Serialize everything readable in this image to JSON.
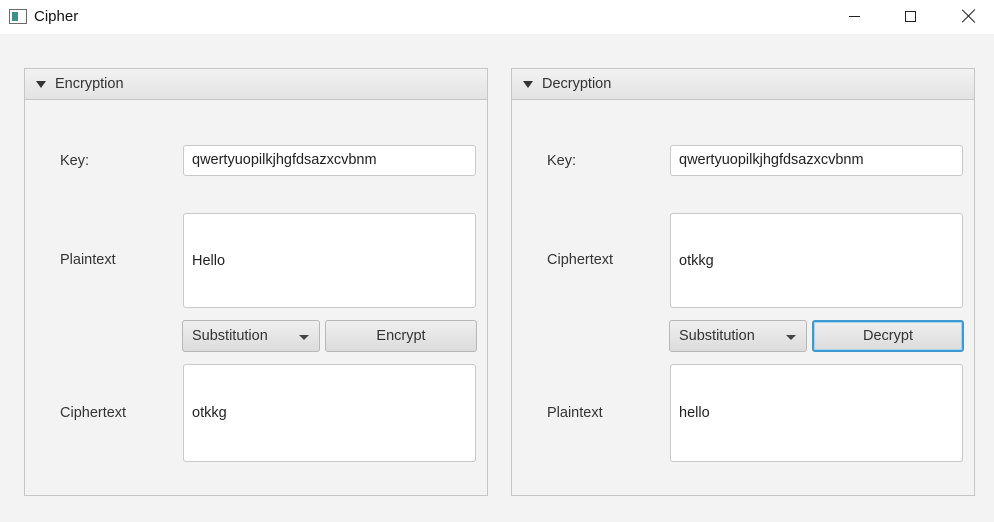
{
  "window": {
    "title": "Cipher",
    "controls": {
      "minimize": "minimize-icon",
      "maximize": "maximize-icon",
      "close": "close-icon"
    }
  },
  "encryption": {
    "title": "Encryption",
    "key_label": "Key:",
    "key_value": "qwertyuopilkjhgfdsazxcvbnm",
    "input_label": "Plaintext",
    "input_value": "Hello",
    "method": "Substitution",
    "action_label": "Encrypt",
    "output_label": "Ciphertext",
    "output_value": "otkkg"
  },
  "decryption": {
    "title": "Decryption",
    "key_label": "Key:",
    "key_value": "qwertyuopilkjhgfdsazxcvbnm",
    "input_label": "Ciphertext",
    "input_value": "otkkg",
    "method": "Substitution",
    "action_label": "Decrypt",
    "output_label": "Plaintext",
    "output_value": "hello"
  },
  "colors": {
    "focus_ring": "#3c9ad3",
    "window_background": "#f3f3f3"
  }
}
